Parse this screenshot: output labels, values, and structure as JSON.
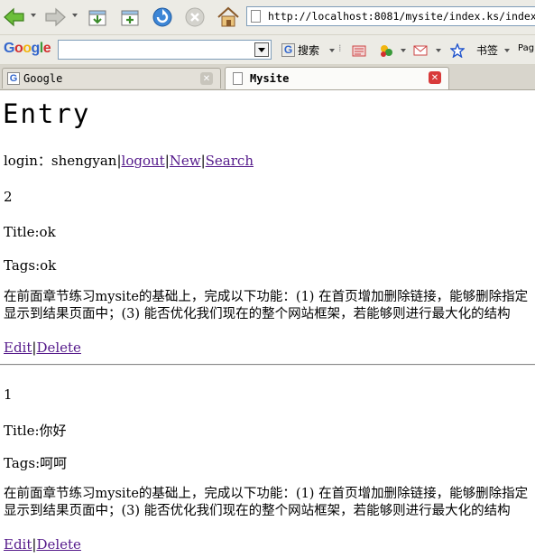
{
  "browser": {
    "url": "http://localhost:8081/mysite/index.ks/index",
    "google_toolbar": {
      "logo": "Google",
      "search_value": "",
      "search_button": "搜索",
      "bookmarks_button": "书签",
      "page_button": "Pag"
    },
    "tabs": [
      {
        "label": "Google",
        "active": false
      },
      {
        "label": "Mysite",
        "active": true
      }
    ]
  },
  "page": {
    "heading": "Entry",
    "nav": {
      "login_text": "login：shengyan",
      "sep": "|",
      "logout": "logout",
      "new": "New",
      "search": "Search"
    },
    "entries": [
      {
        "id": "2",
        "title": "Title:ok",
        "tags": "Tags:ok",
        "body_line1": "在前面章节练习mysite的基础上，完成以下功能：(1) 在首页增加删除链接，能够删除指定",
        "body_line2": "显示到结果页面中；(3) 能否优化我们现在的整个网站框架，若能够则进行最大化的结构",
        "edit": "Edit",
        "delete": "Delete"
      },
      {
        "id": "1",
        "title": "Title:你好",
        "tags": "Tags:呵呵",
        "body_line1": "在前面章节练习mysite的基础上，完成以下功能：(1) 在首页增加删除链接，能够删除指定",
        "body_line2": "显示到结果页面中；(3) 能否优化我们现在的整个网站框架，若能够则进行最大化的结构",
        "edit": "Edit",
        "delete": "Delete"
      }
    ]
  }
}
